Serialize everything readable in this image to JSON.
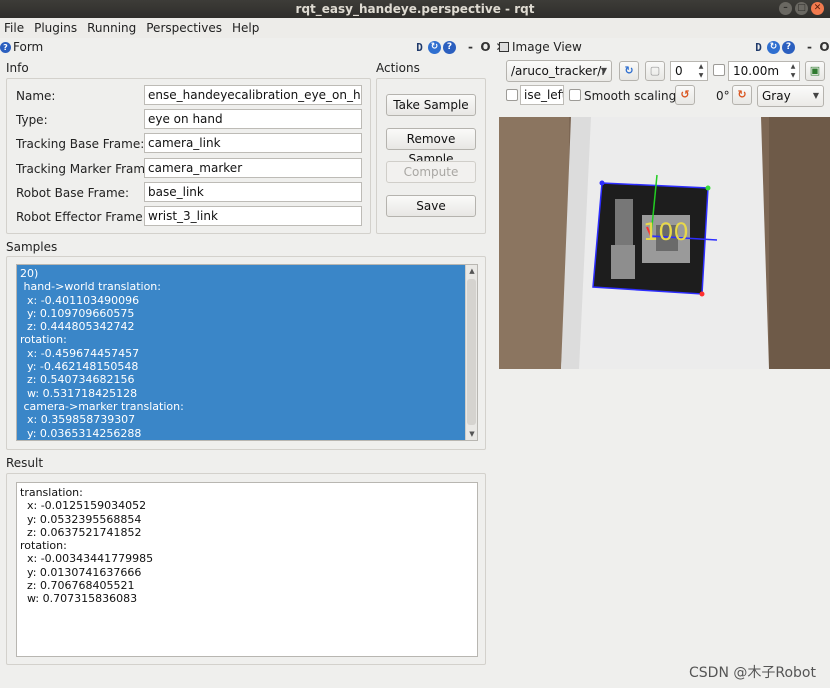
{
  "window": {
    "title": "rqt_easy_handeye.perspective - rqt"
  },
  "menu": [
    "File",
    "Plugins",
    "Running",
    "Perspectives",
    "Help"
  ],
  "form_panel": {
    "title": "Form",
    "controls": {
      "d": "D",
      "min": "-",
      "float": "O",
      "close": "✕"
    },
    "info": {
      "label": "Info",
      "rows": [
        {
          "label": "Name:",
          "value": "ense_handeyecalibration_eye_on_hand/"
        },
        {
          "label": "Type:",
          "value": "eye on hand"
        },
        {
          "label": "Tracking Base Frame:",
          "value": "camera_link"
        },
        {
          "label": "Tracking Marker Frame:",
          "value": "camera_marker"
        },
        {
          "label": "Robot Base Frame:",
          "value": "base_link"
        },
        {
          "label": "Robot Effector Frame:",
          "value": "wrist_3_link"
        }
      ]
    },
    "actions": {
      "label": "Actions",
      "take_sample": "Take Sample",
      "remove_sample": "Remove Sample",
      "compute": "Compute",
      "save": "Save"
    },
    "samples": {
      "label": "Samples",
      "text": "20)\n hand->world translation:\n  x: -0.401103490096\n  y: 0.109709660575\n  z: 0.444805342742\nrotation:\n  x: -0.459674457457\n  y: -0.462148150548\n  z: 0.540734682156\n  w: 0.531718425128\n camera->marker translation:\n  x: 0.359858739307\n  y: 0.0365314256288"
    },
    "result": {
      "label": "Result",
      "text": "translation:\n  x: -0.0125159034052\n  y: 0.0532395568854\n  z: 0.0637521741852\nrotation:\n  x: -0.00343441779985\n  y: 0.0130741637666\n  z: 0.706768405521\n  w: 0.707315836083"
    }
  },
  "image_panel": {
    "title": "Image View",
    "controls": {
      "d": "D",
      "min": "-",
      "float": "O",
      "close": "✕"
    },
    "topic": "/aruco_tracker/r",
    "spin_value": "0",
    "max_value": "10.00m",
    "mouse_topic": "ise_left",
    "smooth_scaling": "Smooth scaling",
    "rotation": "0°",
    "color_scheme": "Gray",
    "marker_label": "100"
  },
  "watermark": "CSDN @木子Robot"
}
